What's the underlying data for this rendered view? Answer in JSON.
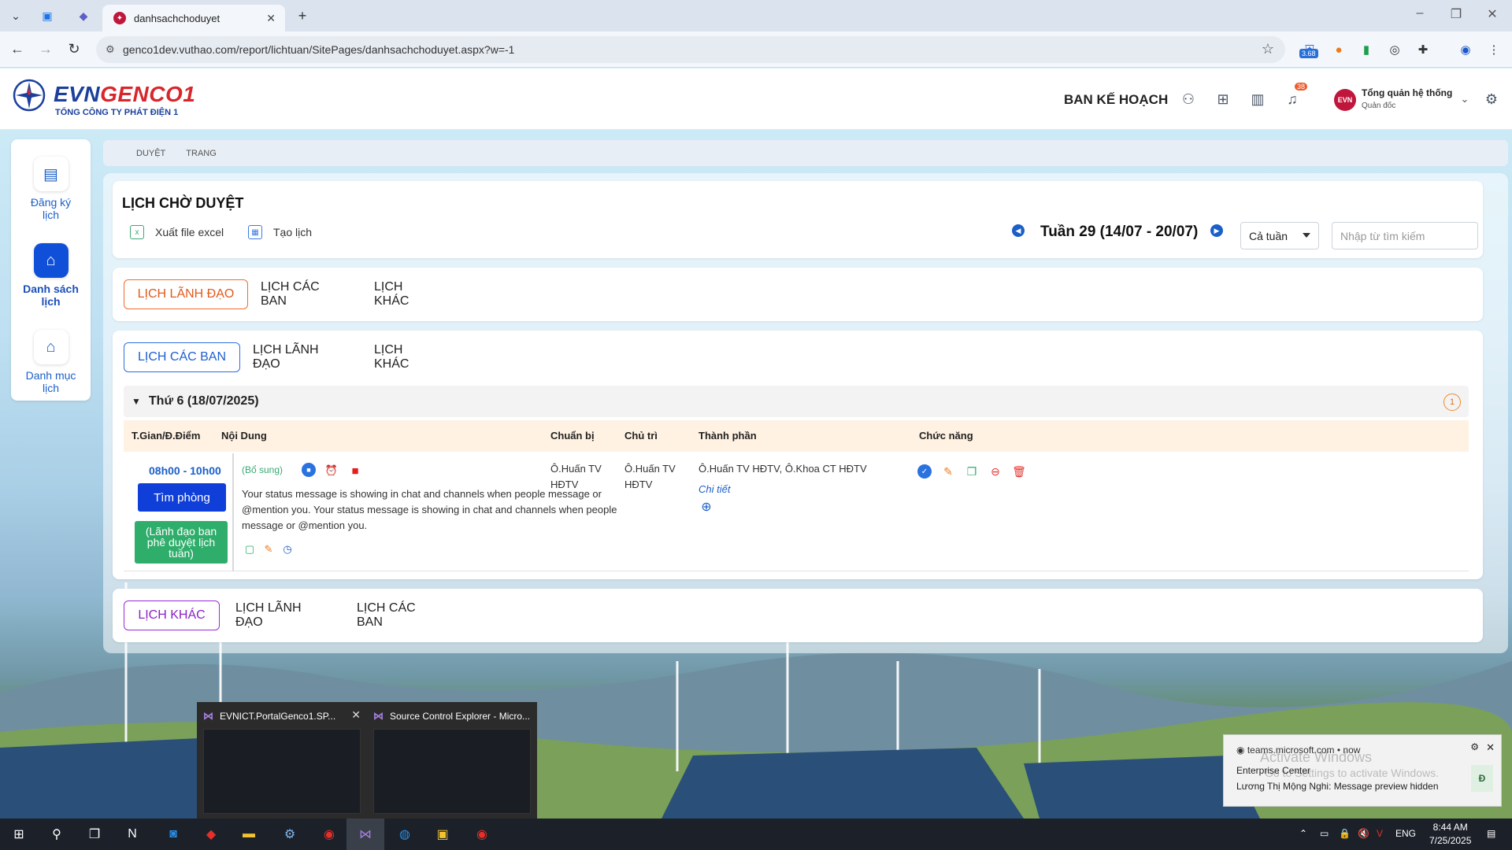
{
  "browser": {
    "tab_title": "danhsachchoduyet",
    "url": "genco1dev.vuthao.com/report/lichtuan/SitePages/danhsachchoduyet.aspx?w=-1",
    "ext_badge": "3.68"
  },
  "header": {
    "logo_evn": "EVN",
    "logo_genco": "GENCO1",
    "logo_sub": "TỔNG CÔNG TY PHÁT ĐIỆN 1",
    "department": "BAN KẾ HOẠCH",
    "notification_count": "38",
    "user_name": "Tổng quản hệ thống",
    "user_role": "Quản đốc"
  },
  "sidebar": {
    "items": [
      {
        "label_line1": "Đăng ký",
        "label_line2": "lịch",
        "icon": "document-icon"
      },
      {
        "label_line1": "Danh sách",
        "label_line2": "lịch",
        "icon": "home-icon"
      },
      {
        "label_line1": "Danh mục",
        "label_line2": "lịch",
        "icon": "home-icon"
      }
    ]
  },
  "breadcrumb": [
    "DUYỆT",
    "TRANG"
  ],
  "page": {
    "title": "LỊCH CHỜ DUYỆT",
    "export_label": "Xuất file excel",
    "create_label": "Tạo lịch",
    "week_label": "Tuần 29 (14/07 - 20/07)",
    "week_select": "Cả tuần",
    "search_placeholder": "Nhập từ tìm kiếm"
  },
  "sections": [
    {
      "tabs": [
        "LỊCH LÃNH ĐẠO",
        "LỊCH CÁC BAN",
        "LỊCH KHÁC"
      ]
    },
    {
      "tabs": [
        "LỊCH CÁC BAN",
        "LỊCH LÃNH ĐẠO",
        "LỊCH KHÁC"
      ]
    },
    {
      "tabs": [
        "LỊCH KHÁC",
        "LỊCH LÃNH ĐẠO",
        "LỊCH CÁC BAN"
      ]
    }
  ],
  "day_group": {
    "label": "Thứ 6 (18/07/2025)",
    "count": "1"
  },
  "table": {
    "columns": [
      "T.Gian/Đ.Điểm",
      "Nội Dung",
      "Chuẩn bị",
      "Chủ trì",
      "Thành phần",
      "Chức năng"
    ],
    "row": {
      "time": "08h00 - 10h00",
      "room_button": "Tìm phòng",
      "status": "(Lãnh đạo ban phê duyệt lịch tuần)",
      "tag": "(Bổ sung)",
      "content": "Your status message is showing in chat and channels when people message or @mention you. Your status message is showing in chat and channels when people message or @mention you.",
      "chuan_bi_1": "Ô.Huấn TV",
      "chuan_bi_2": "HĐTV",
      "chu_tri_1": "Ô.Huấn TV",
      "chu_tri_2": "HĐTV",
      "thanh_phan": "Ô.Huấn TV HĐTV, Ô.Khoa CT HĐTV",
      "detail_link": "Chi tiết"
    }
  },
  "taskbar": {
    "thumb1_title": "EVNICT.PortalGenco1.SP...",
    "thumb2_title": "Source Control Explorer - Micro...",
    "lang": "ENG",
    "time": "8:44 AM",
    "date": "7/25/2025"
  },
  "toast": {
    "source": "teams.microsoft.com",
    "when": "now",
    "line1": "Enterprise Center",
    "line2": "Lương Thị Mộng Nghi: Message preview hidden",
    "watermark1": "Activate Windows",
    "watermark2": "Go to Settings to activate Windows."
  },
  "colors": {
    "accent_blue": "#1050d8",
    "status_green": "#2eae6a",
    "tab_orange": "#f26b2b",
    "tab_purple": "#9c2ad6"
  }
}
